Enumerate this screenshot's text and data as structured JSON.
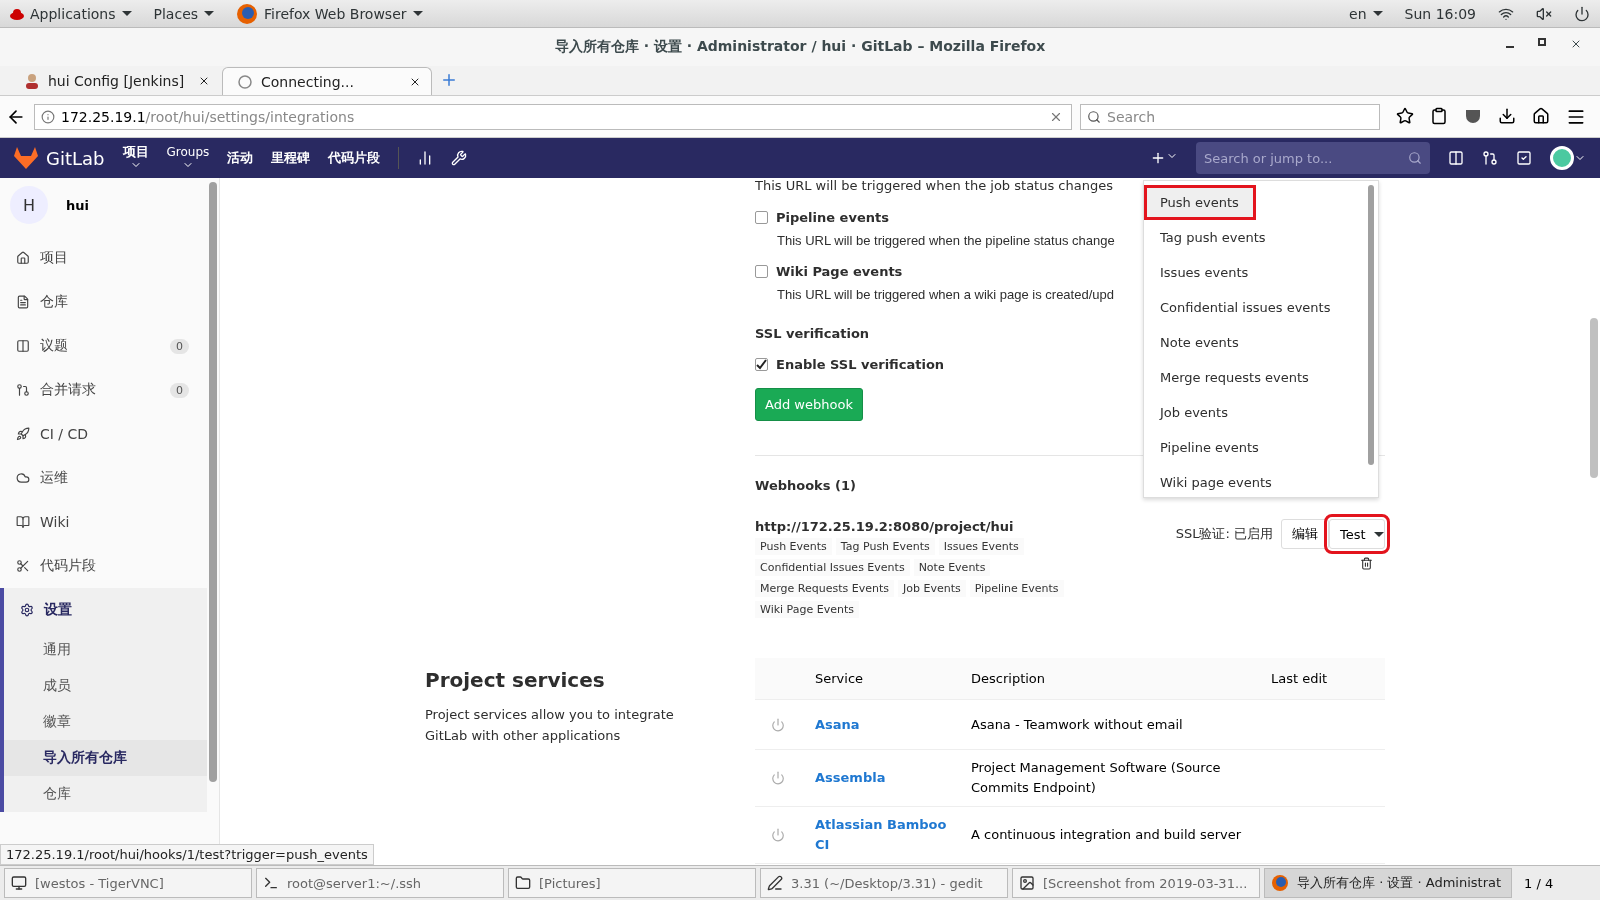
{
  "top_bar": {
    "menus": [
      "Applications",
      "Places",
      "Firefox Web Browser"
    ],
    "language": "en",
    "clock": "Sun 16:09"
  },
  "window": {
    "title": "导入所有仓库 · 设置 · Administrator / hui · GitLab – Mozilla Firefox"
  },
  "tabs": [
    {
      "label": "hui Config [Jenkins]",
      "selected": false,
      "kind": "avatar"
    },
    {
      "label": "Connecting...",
      "selected": true,
      "kind": "loading"
    }
  ],
  "url_bar": {
    "host": "172.25.19.1",
    "path": "/root/hui/settings/integrations"
  },
  "browser_search": {
    "placeholder": "Search"
  },
  "gitlab_nav": {
    "brand": "GitLab",
    "items": [
      {
        "label": "项目",
        "dropdown": true
      },
      {
        "label": "Groups",
        "dropdown": true
      },
      {
        "label": "活动",
        "dropdown": false
      },
      {
        "label": "里程碑",
        "dropdown": false
      },
      {
        "label": "代码片段",
        "dropdown": false
      }
    ],
    "search": {
      "placeholder": "Search or jump to..."
    }
  },
  "sidebar": {
    "project": {
      "initial": "H",
      "name": "hui"
    },
    "items": [
      {
        "label": "项目",
        "selected": false
      },
      {
        "label": "仓库",
        "selected": false
      },
      {
        "label": "议题",
        "count": "0",
        "selected": false
      },
      {
        "label": "合并请求",
        "count": "0",
        "selected": false
      },
      {
        "label": "CI / CD",
        "selected": false
      },
      {
        "label": "运维",
        "selected": false
      },
      {
        "label": "Wiki",
        "selected": false
      },
      {
        "label": "代码片段",
        "selected": false
      },
      {
        "label": "设置",
        "selected": true,
        "children": [
          {
            "label": "通用",
            "selected": false
          },
          {
            "label": "成员",
            "selected": false
          },
          {
            "label": "徽章",
            "selected": false
          },
          {
            "label": "导入所有仓库",
            "selected": true
          },
          {
            "label": "仓库",
            "selected": false
          }
        ]
      }
    ]
  },
  "webhook_form": {
    "cut_line": "This URL will be triggered when the job status changes",
    "triggers": [
      {
        "label": "Pipeline events",
        "checked": false,
        "description": "This URL will be triggered when the pipeline status change"
      },
      {
        "label": "Wiki Page events",
        "checked": false,
        "description": "This URL will be triggered when a wiki page is created/upd"
      }
    ],
    "ssl_heading": "SSL verification",
    "ssl_option": {
      "label": "Enable SSL verification",
      "checked": true
    },
    "submit": "Add webhook"
  },
  "webhooks": {
    "heading": "Webhooks (1)",
    "items": [
      {
        "url": "http://172.25.19.2:8080/project/hui",
        "ssl_status": "SSL验证: 已启用",
        "edit": "编辑",
        "test": "Test",
        "test_highlighted": true,
        "events": [
          [
            "Push Events",
            "Tag Push Events",
            "Issues Events"
          ],
          [
            "Confidential Issues Events",
            "Note Events"
          ],
          [
            "Merge Requests Events",
            "Job Events",
            "Pipeline Events"
          ],
          [
            "Wiki Page Events"
          ]
        ]
      }
    ]
  },
  "test_menu": {
    "items": [
      {
        "label": "Push events",
        "selected": true,
        "highlighted": true
      },
      {
        "label": "Tag push events",
        "selected": false,
        "highlighted": false
      },
      {
        "label": "Issues events",
        "selected": false,
        "highlighted": false
      },
      {
        "label": "Confidential issues events",
        "selected": false,
        "highlighted": false
      },
      {
        "label": "Note events",
        "selected": false,
        "highlighted": false
      },
      {
        "label": "Merge requests events",
        "selected": false,
        "highlighted": false
      },
      {
        "label": "Job events",
        "selected": false,
        "highlighted": false
      },
      {
        "label": "Pipeline events",
        "selected": false,
        "highlighted": false
      },
      {
        "label": "Wiki page events",
        "selected": false,
        "highlighted": false
      }
    ]
  },
  "project_services": {
    "heading": "Project services",
    "description": "Project services allow you to integrate GitLab with other applications",
    "columns": [
      "Service",
      "Description",
      "Last edit"
    ],
    "rows": [
      {
        "service": "Asana",
        "description": "Asana - Teamwork without email"
      },
      {
        "service": "Assembla",
        "description": "Project Management Software (Source Commits Endpoint)"
      },
      {
        "service": "Atlassian Bamboo CI",
        "description": "A continuous integration and build server"
      }
    ]
  },
  "status_link": "172.25.19.1/root/hui/hooks/1/test?trigger=push_events",
  "taskbar": {
    "items": [
      {
        "label": "[westos - TigerVNC]",
        "selected": false
      },
      {
        "label": "root@server1:~/.ssh",
        "selected": false
      },
      {
        "label": "[Pictures]",
        "selected": false
      },
      {
        "label": "3.31 (~/Desktop/3.31) - gedit",
        "selected": false
      },
      {
        "label": "[Screenshot from 2019-03-31...",
        "selected": false
      },
      {
        "label": "导入所有仓库 · 设置 · Administrat",
        "selected": true
      }
    ],
    "pager": "1 / 4"
  }
}
